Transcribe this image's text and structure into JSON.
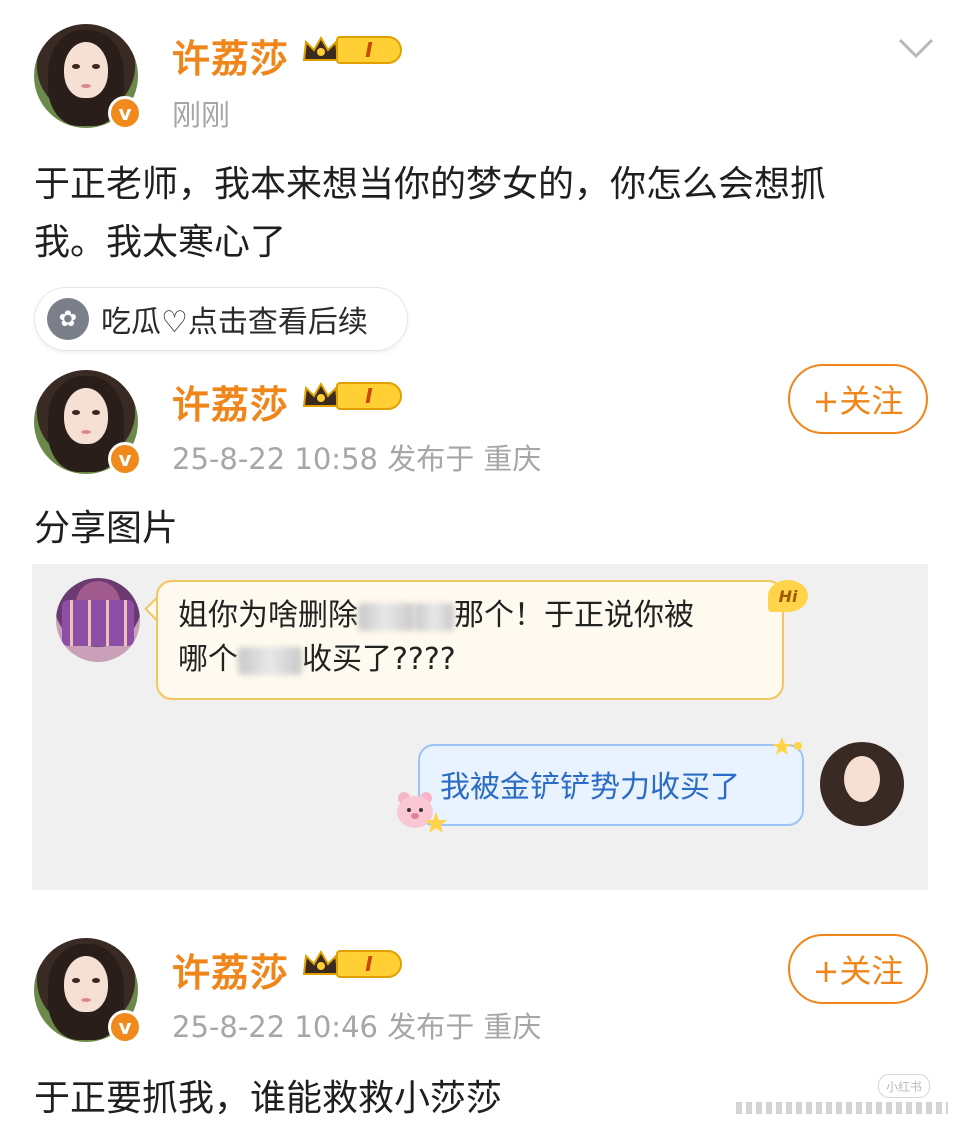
{
  "colors": {
    "accent_orange": "#f0851a",
    "meta_gray": "#a6a6a6",
    "bubble_left_border": "#f4c55a",
    "bubble_right_border": "#9cc3f5",
    "bubble_right_text": "#2b6cc5"
  },
  "post1": {
    "username": "许荔莎",
    "level": "I",
    "time": "刚刚",
    "text_line1": "于正老师，我本来想当你的梦女的，你怎么会想抓",
    "text_line2": "我。我太寒心了",
    "topic": "吃瓜♡点击查看后续"
  },
  "post2": {
    "username": "许荔莎",
    "level": "I",
    "meta": "25-8-22 10:58  发布于 重庆",
    "follow": "+关注",
    "text": "分享图片",
    "chat": {
      "left_line1_a": "姐你为啥删除",
      "left_line1_b": "那个！于正说你被",
      "left_line2_a": "哪个",
      "left_line2_b": "收买了????",
      "hi": "Hi",
      "right": "我被金铲铲势力收买了"
    }
  },
  "post3": {
    "username": "许荔莎",
    "level": "I",
    "meta": "25-8-22 10:46  发布于 重庆",
    "follow": "+关注",
    "text": "于正要抓我，谁能救救小莎莎"
  },
  "watermark": "小红书"
}
